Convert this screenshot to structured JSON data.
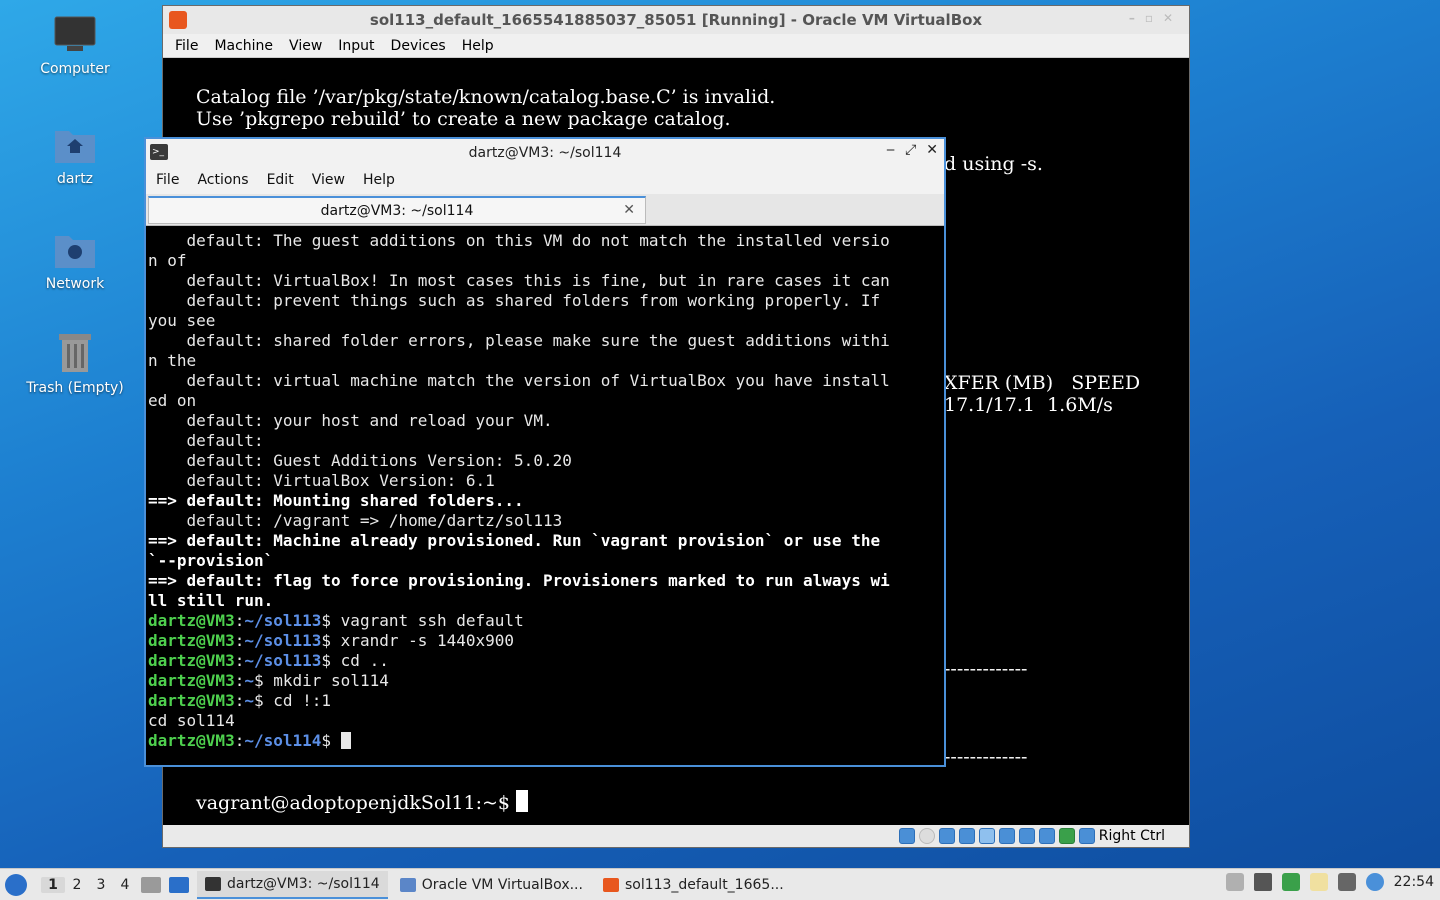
{
  "desktop": {
    "icons": [
      {
        "label": "Computer",
        "icon": "computer-icon"
      },
      {
        "label": "dartz",
        "icon": "home-folder-icon"
      },
      {
        "label": "Network",
        "icon": "network-folder-icon"
      },
      {
        "label": "Trash (Empty)",
        "icon": "trash-icon"
      }
    ]
  },
  "vbox": {
    "title": "sol113_default_1665541885037_85051 [Running] - Oracle VM VirtualBox",
    "menu": [
      "File",
      "Machine",
      "View",
      "Input",
      "Devices",
      "Help"
    ],
    "screen_lines": [
      "Catalog file ’/var/pkg/state/known/catalog.base.C’ is invalid.",
      "Use ’pkgrepo rebuild’ to create a new package catalog."
    ],
    "screen_fragment_using": "d using -s.",
    "screen_fragment_header": "XFER (MB)   SPEED",
    "screen_fragment_values": "17.1/17.1  1.6M/s",
    "screen_dashes": "-------------",
    "prompt": "vagrant@adoptopenjdkSol11:~$ ",
    "status_host_key": "Right Ctrl"
  },
  "terminal": {
    "title": "dartz@VM3: ~/sol114",
    "menu": [
      "File",
      "Actions",
      "Edit",
      "View",
      "Help"
    ],
    "tab_label": "dartz@VM3: ~/sol114",
    "lines": [
      "    default: The guest additions on this VM do not match the installed versio",
      "n of",
      "    default: VirtualBox! In most cases this is fine, but in rare cases it can",
      "    default: prevent things such as shared folders from working properly. If",
      "you see",
      "    default: shared folder errors, please make sure the guest additions withi",
      "n the",
      "    default: virtual machine match the version of VirtualBox you have install",
      "ed on",
      "    default: your host and reload your VM.",
      "    default:",
      "    default: Guest Additions Version: 5.0.20",
      "    default: VirtualBox Version: 6.1"
    ],
    "bold_lines": [
      "==> default: Mounting shared folders...",
      "    default: /vagrant => /home/dartz/sol113",
      "==> default: Machine already provisioned. Run `vagrant provision` or use the",
      "`--provision`",
      "==> default: flag to force provisioning. Provisioners marked to run always wi",
      "ll still run."
    ],
    "prompt_user": "dartz@VM3",
    "commands": [
      {
        "path": "~/sol113",
        "cmd": "vagrant ssh default"
      },
      {
        "path": "~/sol113",
        "cmd": "xrandr -s 1440x900"
      },
      {
        "path": "~/sol113",
        "cmd": "cd .."
      },
      {
        "path": "~",
        "cmd": "mkdir sol114"
      },
      {
        "path": "~",
        "cmd": "cd !:1"
      }
    ],
    "echo_line": "cd sol114",
    "final_path": "~/sol114"
  },
  "taskbar": {
    "workspaces": [
      "1",
      "2",
      "3",
      "4"
    ],
    "tasks": [
      {
        "label": "dartz@VM3: ~/sol114",
        "icon": "terminal-icon"
      },
      {
        "label": "Oracle VM VirtualBox...",
        "icon": "virtualbox-icon"
      },
      {
        "label": "sol113_default_1665...",
        "icon": "vm-window-icon"
      }
    ],
    "clock": "22:54"
  }
}
